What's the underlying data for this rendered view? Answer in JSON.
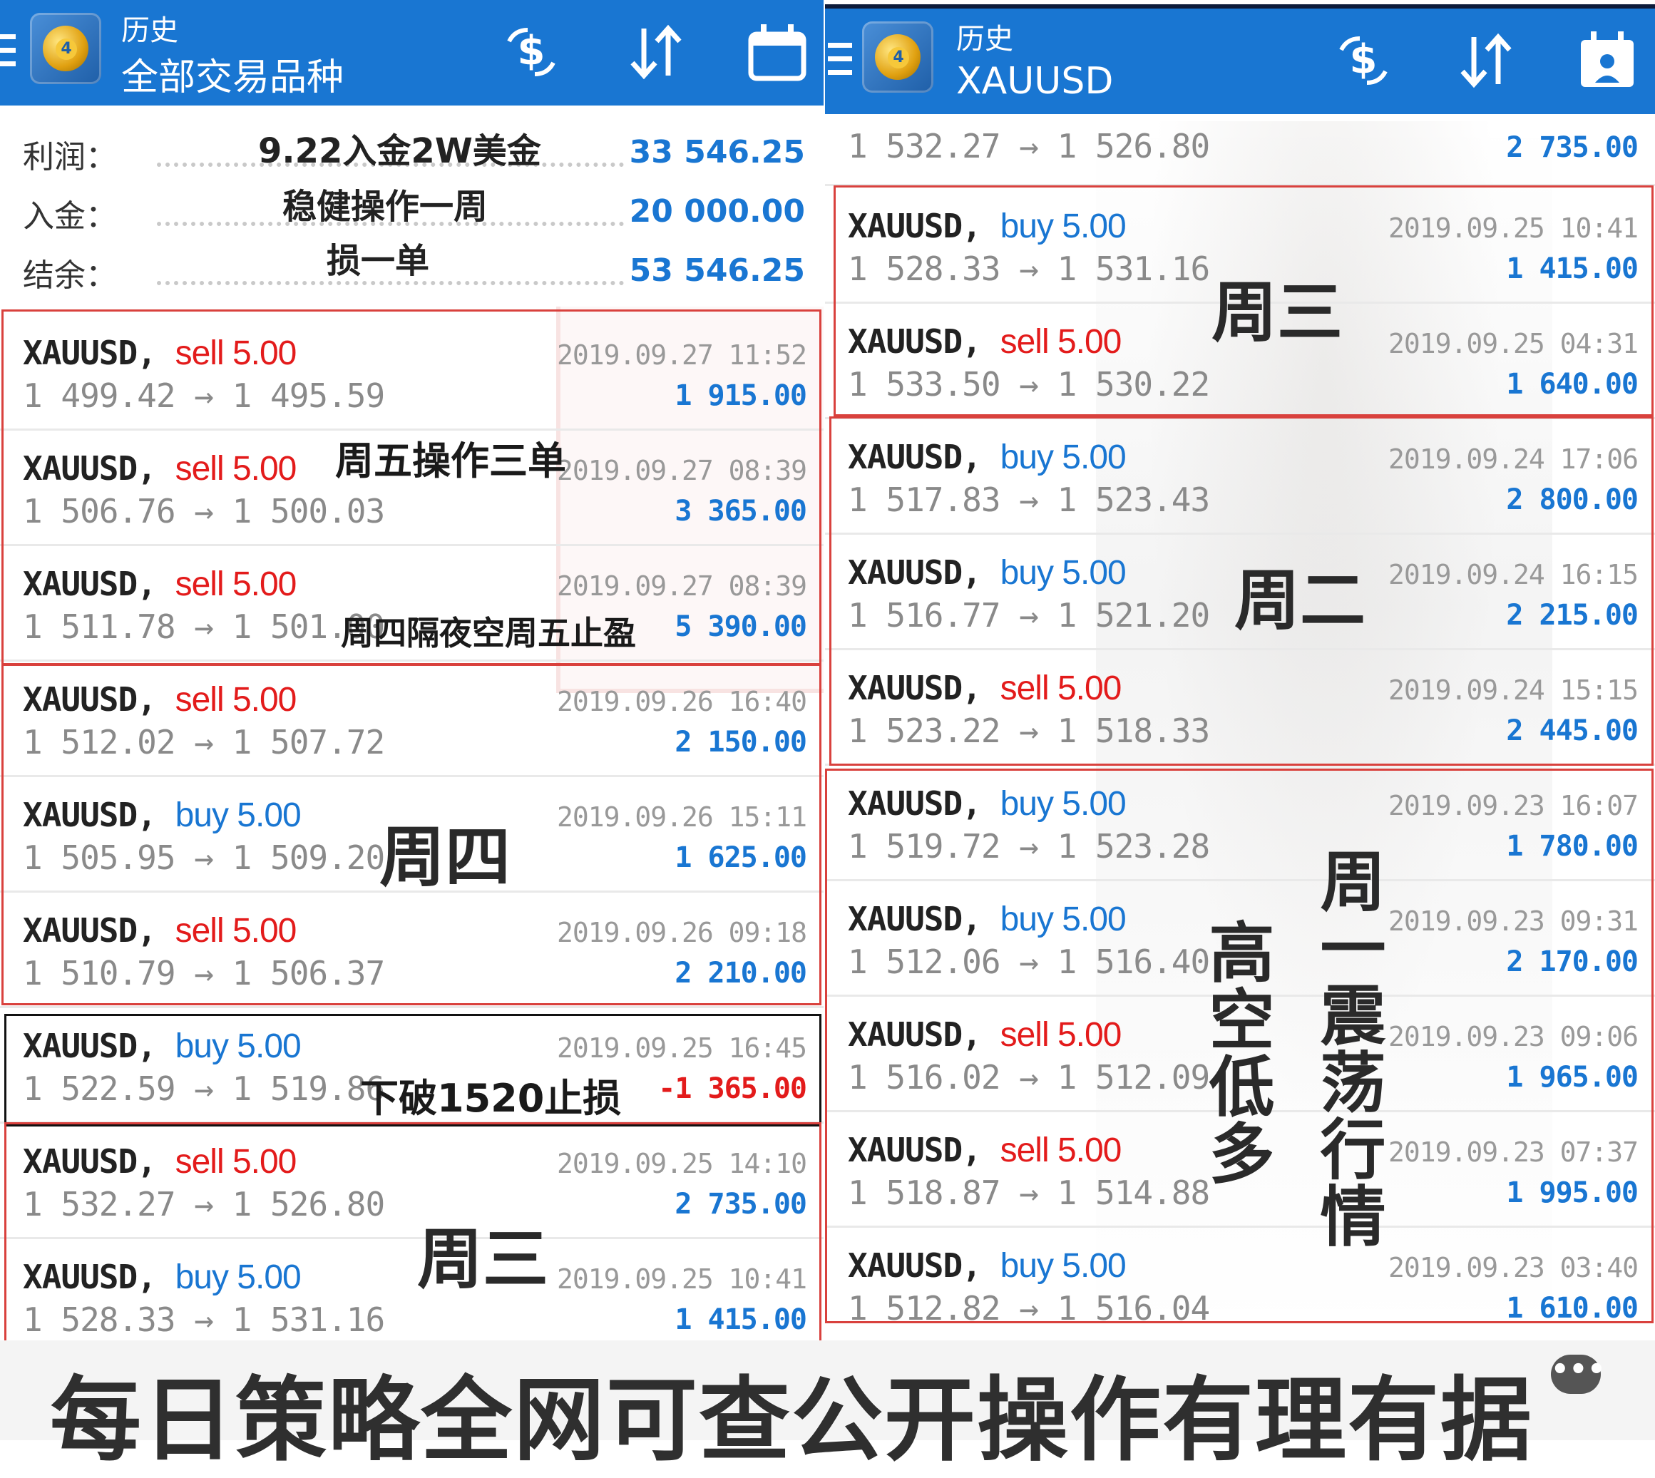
{
  "left": {
    "header": {
      "small": "历史",
      "big": "全部交易品种"
    },
    "summary": [
      {
        "label": "利润：",
        "value": "33 546.25"
      },
      {
        "label": "入金：",
        "value": "20 000.00"
      },
      {
        "label": "结余：",
        "value": "53 546.25"
      }
    ],
    "summary_notes": [
      "9.22入金2W美金",
      "稳健操作一周",
      "损一单"
    ],
    "trades": [
      {
        "symbol": "XAUUSD,",
        "side": "sell 5.00",
        "type": "sell",
        "prices": "1 499.42 → 1 495.59",
        "date": "2019.09.27 11:52",
        "profit": "1 915.00"
      },
      {
        "symbol": "XAUUSD,",
        "side": "sell 5.00",
        "type": "sell",
        "prices": "1 506.76 → 1 500.03",
        "date": "2019.09.27 08:39",
        "profit": "3 365.00"
      },
      {
        "symbol": "XAUUSD,",
        "side": "sell 5.00",
        "type": "sell",
        "prices": "1 511.78 → 1 501.00",
        "date": "2019.09.27 08:39",
        "profit": "5 390.00"
      },
      {
        "symbol": "XAUUSD,",
        "side": "sell 5.00",
        "type": "sell",
        "prices": "1 512.02 → 1 507.72",
        "date": "2019.09.26 16:40",
        "profit": "2 150.00"
      },
      {
        "symbol": "XAUUSD,",
        "side": "buy 5.00",
        "type": "buy",
        "prices": "1 505.95 → 1 509.20",
        "date": "2019.09.26 15:11",
        "profit": "1 625.00"
      },
      {
        "symbol": "XAUUSD,",
        "side": "sell 5.00",
        "type": "sell",
        "prices": "1 510.79 → 1 506.37",
        "date": "2019.09.26 09:18",
        "profit": "2 210.00"
      },
      {
        "symbol": "XAUUSD,",
        "side": "buy 5.00",
        "type": "buy",
        "prices": "1 522.59 → 1 519.86",
        "date": "2019.09.25 16:45",
        "profit": "-1 365.00"
      },
      {
        "symbol": "XAUUSD,",
        "side": "sell 5.00",
        "type": "sell",
        "prices": "1 532.27 → 1 526.80",
        "date": "2019.09.25 14:10",
        "profit": "2 735.00"
      },
      {
        "symbol": "XAUUSD,",
        "side": "buy 5.00",
        "type": "buy",
        "prices": "1 528.33 → 1 531.16",
        "date": "2019.09.25 10:41",
        "profit": "1 415.00"
      }
    ],
    "annotations": {
      "friday": "周五操作三单",
      "thu_overnight": "周四隔夜空周五止盈",
      "thursday": "周四",
      "stoploss": "下破1520止损",
      "wednesday": "周三"
    }
  },
  "right": {
    "header": {
      "small": "历史",
      "big": "XAUUSD"
    },
    "partial_top": {
      "prices": "1 532.27 → 1 526.80",
      "profit": "2 735.00"
    },
    "trades": [
      {
        "symbol": "XAUUSD,",
        "side": "buy 5.00",
        "type": "buy",
        "prices": "1 528.33 → 1 531.16",
        "date": "2019.09.25 10:41",
        "profit": "1 415.00"
      },
      {
        "symbol": "XAUUSD,",
        "side": "sell 5.00",
        "type": "sell",
        "prices": "1 533.50 → 1 530.22",
        "date": "2019.09.25 04:31",
        "profit": "1 640.00"
      },
      {
        "symbol": "XAUUSD,",
        "side": "buy 5.00",
        "type": "buy",
        "prices": "1 517.83 → 1 523.43",
        "date": "2019.09.24 17:06",
        "profit": "2 800.00"
      },
      {
        "symbol": "XAUUSD,",
        "side": "buy 5.00",
        "type": "buy",
        "prices": "1 516.77 → 1 521.20",
        "date": "2019.09.24 16:15",
        "profit": "2 215.00"
      },
      {
        "symbol": "XAUUSD,",
        "side": "sell 5.00",
        "type": "sell",
        "prices": "1 523.22 → 1 518.33",
        "date": "2019.09.24 15:15",
        "profit": "2 445.00"
      },
      {
        "symbol": "XAUUSD,",
        "side": "buy 5.00",
        "type": "buy",
        "prices": "1 519.72 → 1 523.28",
        "date": "2019.09.23 16:07",
        "profit": "1 780.00"
      },
      {
        "symbol": "XAUUSD,",
        "side": "buy 5.00",
        "type": "buy",
        "prices": "1 512.06 → 1 516.40",
        "date": "2019.09.23 09:31",
        "profit": "2 170.00"
      },
      {
        "symbol": "XAUUSD,",
        "side": "sell 5.00",
        "type": "sell",
        "prices": "1 516.02 → 1 512.09",
        "date": "2019.09.23 09:06",
        "profit": "1 965.00"
      },
      {
        "symbol": "XAUUSD,",
        "side": "sell 5.00",
        "type": "sell",
        "prices": "1 518.87 → 1 514.88",
        "date": "2019.09.23 07:37",
        "profit": "1 995.00"
      },
      {
        "symbol": "XAUUSD,",
        "side": "buy 5.00",
        "type": "buy",
        "prices": "1 512.82 → 1 516.04",
        "date": "2019.09.23 03:40",
        "profit": "1 610.00"
      }
    ],
    "annotations": {
      "wednesday": "周三",
      "tuesday": "周二",
      "monday_vert": "周一震荡行情",
      "high_short_vert": "高空低多"
    }
  },
  "banner": "每日策略全网可查公开操作有理有据",
  "icons": {
    "menu": "hamburger-icon",
    "logo": "metatrader4-logo",
    "exchange": "currency-exchange-icon",
    "sort": "sort-icon",
    "calendar": "calendar-icon",
    "chat": "chat-icon"
  },
  "colors": {
    "appbar": "#1976d2",
    "sell": "#e31b1b",
    "buy": "#1976d2",
    "profit": "#1976d2",
    "loss": "#e31b1b",
    "box": "#d9413d"
  }
}
